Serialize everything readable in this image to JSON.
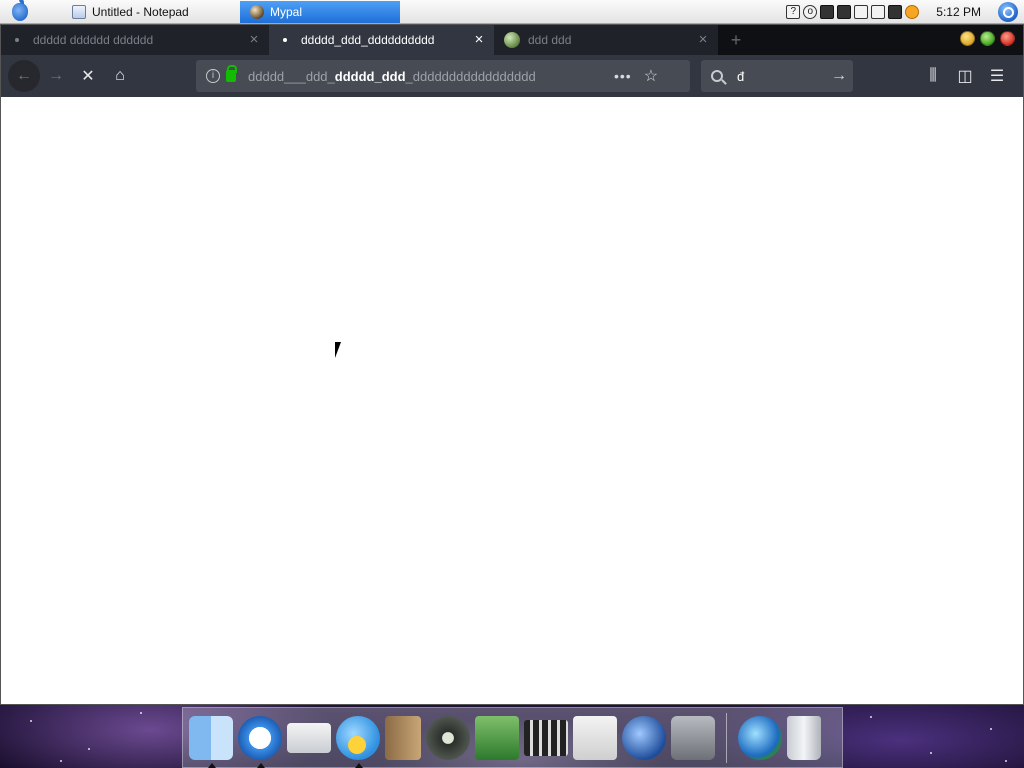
{
  "menubar": {
    "tasks": [
      {
        "label": "Untitled - Notepad"
      },
      {
        "label": "Mypal"
      }
    ],
    "clock": "5:12 PM"
  },
  "browser": {
    "tabs": [
      {
        "title": "ddddd dddddd dddddd"
      },
      {
        "title": "ddddd_ddd_dddddddddd"
      },
      {
        "title": "ddd ddd"
      }
    ],
    "url": {
      "prefix": "ddddd___ddd_",
      "host": "ddddd_ddd",
      "suffix": "_ddddddddddddddddd"
    },
    "search_value": "đ"
  },
  "colors": {
    "selected_tab_bg": "#323640",
    "lock_green": "#12bc00",
    "taskbar_active": "#1e6fd8"
  }
}
